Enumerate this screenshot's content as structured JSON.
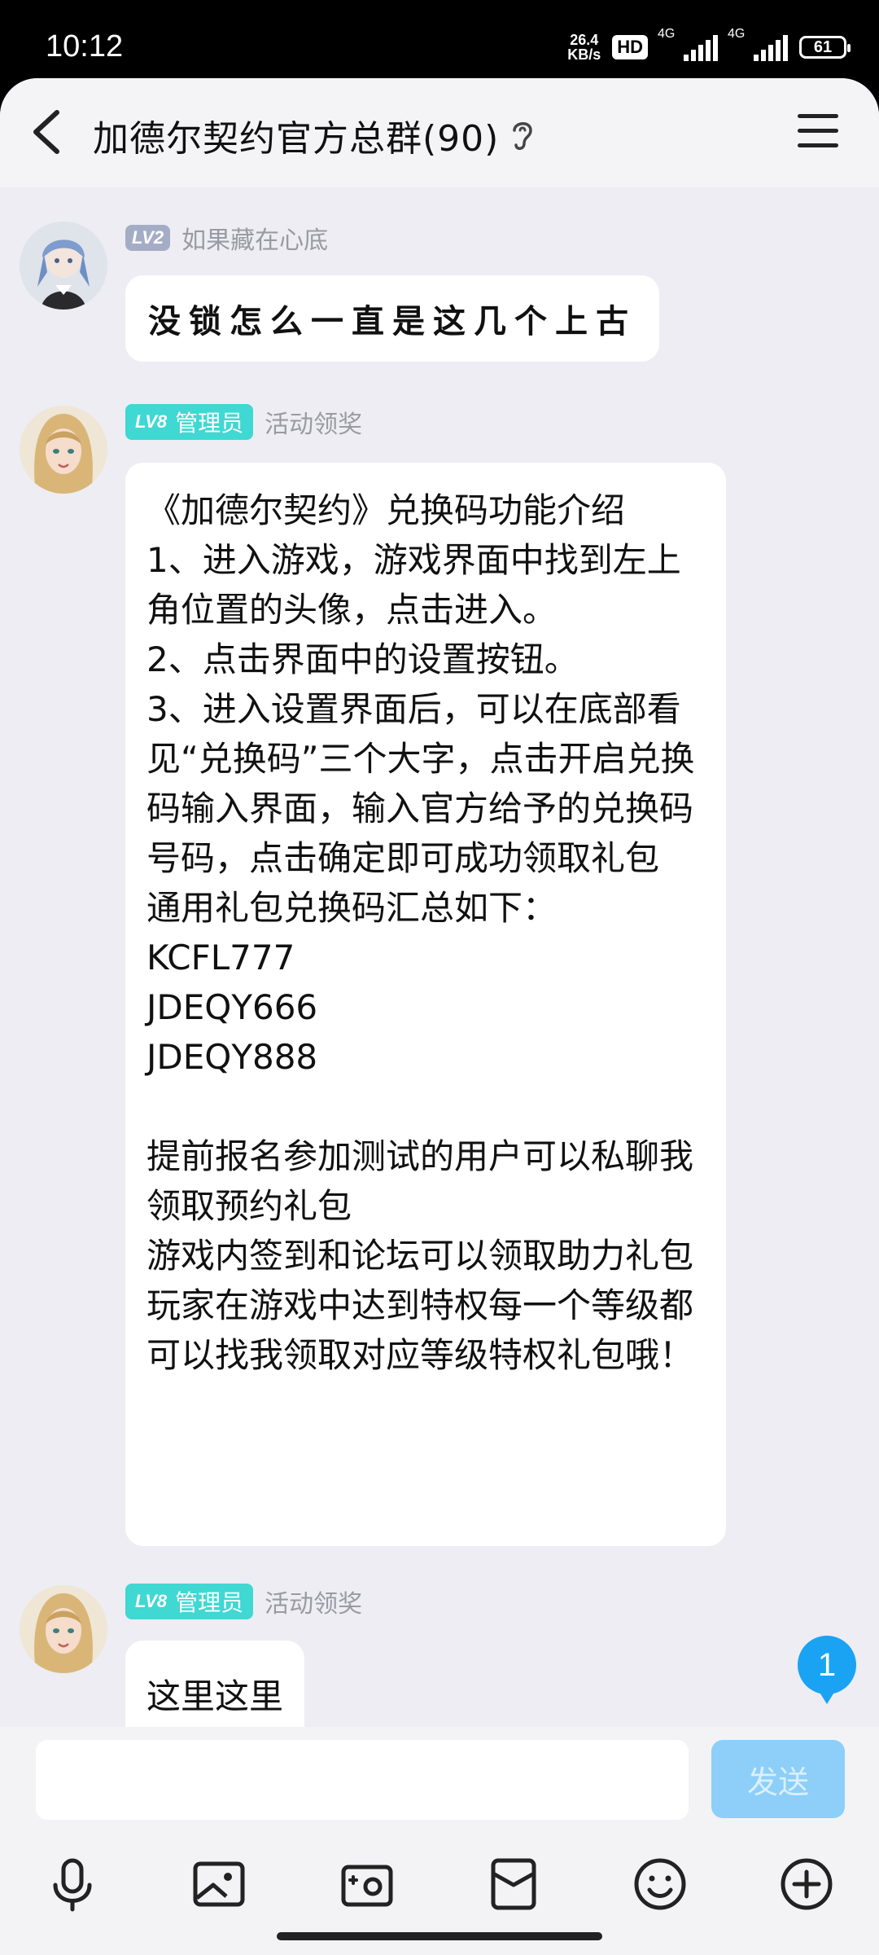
{
  "status_bar": {
    "time": "10:12",
    "net_speed": "26.4",
    "net_unit": "KB/s",
    "hd": "HD",
    "sig1": "4G",
    "sig2": "4G",
    "battery": "61"
  },
  "header": {
    "title": "加德尔契约官方总群(90)"
  },
  "messages": [
    {
      "level": "LV2",
      "name": "如果藏在心底",
      "text": "没锁怎么一直是这几个上古"
    },
    {
      "level": "LV8",
      "role": "管理员",
      "name": "活动领奖",
      "text": "《加德尔契约》兑换码功能介绍\n1、进入游戏，游戏界面中找到左上角位置的头像，点击进入。\n2、点击界面中的设置按钮。\n3、进入设置界面后，可以在底部看见“兑换码”三个大字，点击开启兑换码输入界面，输入官方给予的兑换码号码，点击确定即可成功领取礼包\n通用礼包兑换码汇总如下：\nKCFL777\nJDEQY666\nJDEQY888\n\n提前报名参加测试的用户可以私聊我领取预约礼包\n游戏内签到和论坛可以领取助力礼包\n玩家在游戏中达到特权每一个等级都可以找我领取对应等级特权礼包哦！"
    },
    {
      "level": "LV8",
      "role": "管理员",
      "name": "活动领奖",
      "text": "这里这里"
    }
  ],
  "unread_badge": "1",
  "composer": {
    "input_value": "",
    "send_label": "发送"
  },
  "toolbar_icons": [
    "microphone-icon",
    "image-icon",
    "camera-icon",
    "red-packet-icon",
    "emoji-icon",
    "plus-icon"
  ],
  "colors": {
    "accent": "#1aa3f3",
    "admin_badge": "#3fd8d2",
    "send_disabled": "#8dcff9"
  }
}
